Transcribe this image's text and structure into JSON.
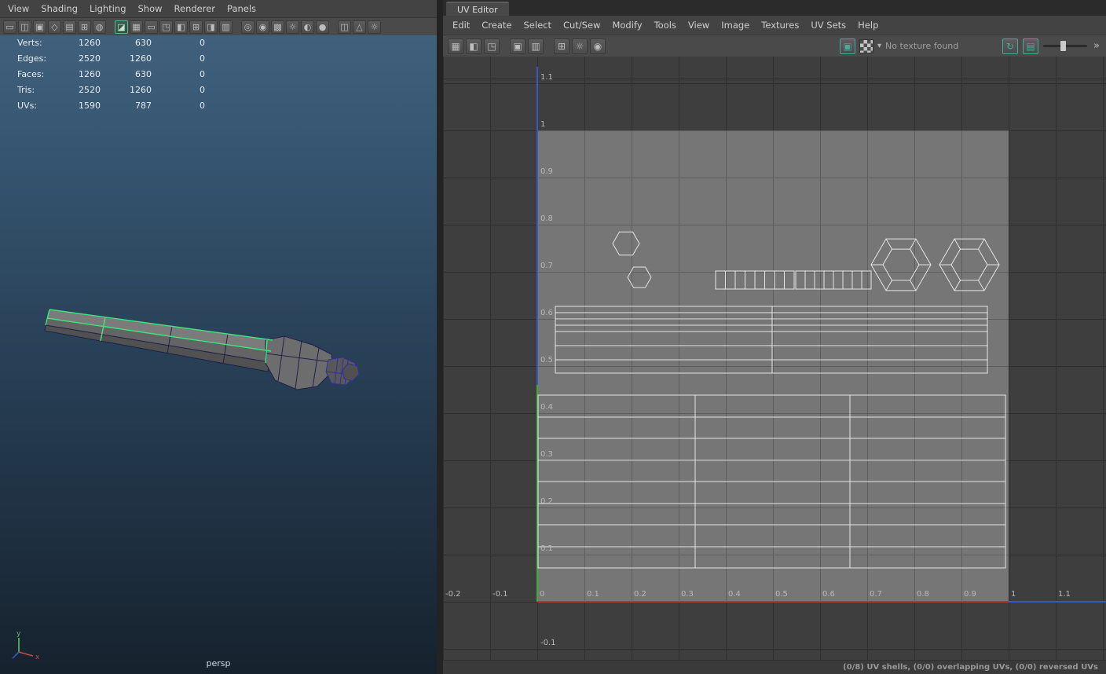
{
  "left_panel": {
    "menu": [
      "View",
      "Shading",
      "Lighting",
      "Show",
      "Renderer",
      "Panels"
    ],
    "hud": {
      "rows": [
        {
          "label": "Verts:",
          "total": "1260",
          "selected": "630",
          "third": "0"
        },
        {
          "label": "Edges:",
          "total": "2520",
          "selected": "1260",
          "third": "0"
        },
        {
          "label": "Faces:",
          "total": "1260",
          "selected": "630",
          "third": "0"
        },
        {
          "label": "Tris:",
          "total": "2520",
          "selected": "1260",
          "third": "0"
        },
        {
          "label": "UVs:",
          "total": "1590",
          "selected": "787",
          "third": "0"
        }
      ]
    },
    "camera_label": "persp",
    "axis_gizmo": {
      "x": "x",
      "y": "y"
    }
  },
  "uv_editor": {
    "tab_title": "UV Editor",
    "menu": [
      "Edit",
      "Create",
      "Select",
      "Cut/Sew",
      "Modify",
      "Tools",
      "View",
      "Image",
      "Textures",
      "UV Sets",
      "Help"
    ],
    "toolbar": {
      "texture_status": "No texture found"
    },
    "grid": {
      "x_ticks": [
        "-0.2",
        "-0.1",
        "0",
        "0.1",
        "0.2",
        "0.3",
        "0.4",
        "0.5",
        "0.6",
        "0.7",
        "0.8",
        "0.9",
        "1",
        "1.1"
      ],
      "y_ticks": [
        "1.1",
        "1",
        "0.9",
        "0.8",
        "0.7",
        "0.6",
        "0.5",
        "0.4",
        "0.3",
        "0.2",
        "0.1",
        "-0.1"
      ]
    },
    "status_bar": "(0/8) UV shells, (0/0) overlapping UVs, (0/0) reversed UVs"
  },
  "colors": {
    "axis_u": "#b03a3a",
    "axis_v": "#3fae3f",
    "axis_w": "#3a57c4",
    "sel_green": "#3fe57d",
    "teal": "#49a898"
  }
}
